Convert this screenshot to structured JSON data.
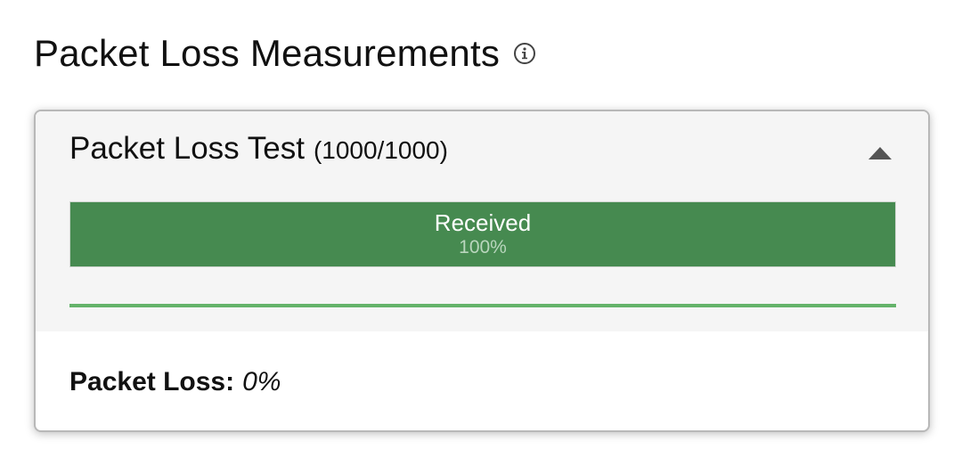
{
  "page": {
    "title": "Packet Loss Measurements",
    "info_icon": "info-circle-icon"
  },
  "test": {
    "name": "Packet Loss Test",
    "count": "(1000/1000)",
    "collapse_icon": "triangle-up-icon",
    "bar": {
      "label": "Received",
      "percent_text": "100%",
      "fraction": 1.0
    },
    "progress_fraction": 1.0
  },
  "summary": {
    "label": "Packet Loss:",
    "value": "0%"
  },
  "colors": {
    "received_bar": "#468a50",
    "progress_line": "#64b36a",
    "card_header_bg": "#f5f5f5"
  }
}
